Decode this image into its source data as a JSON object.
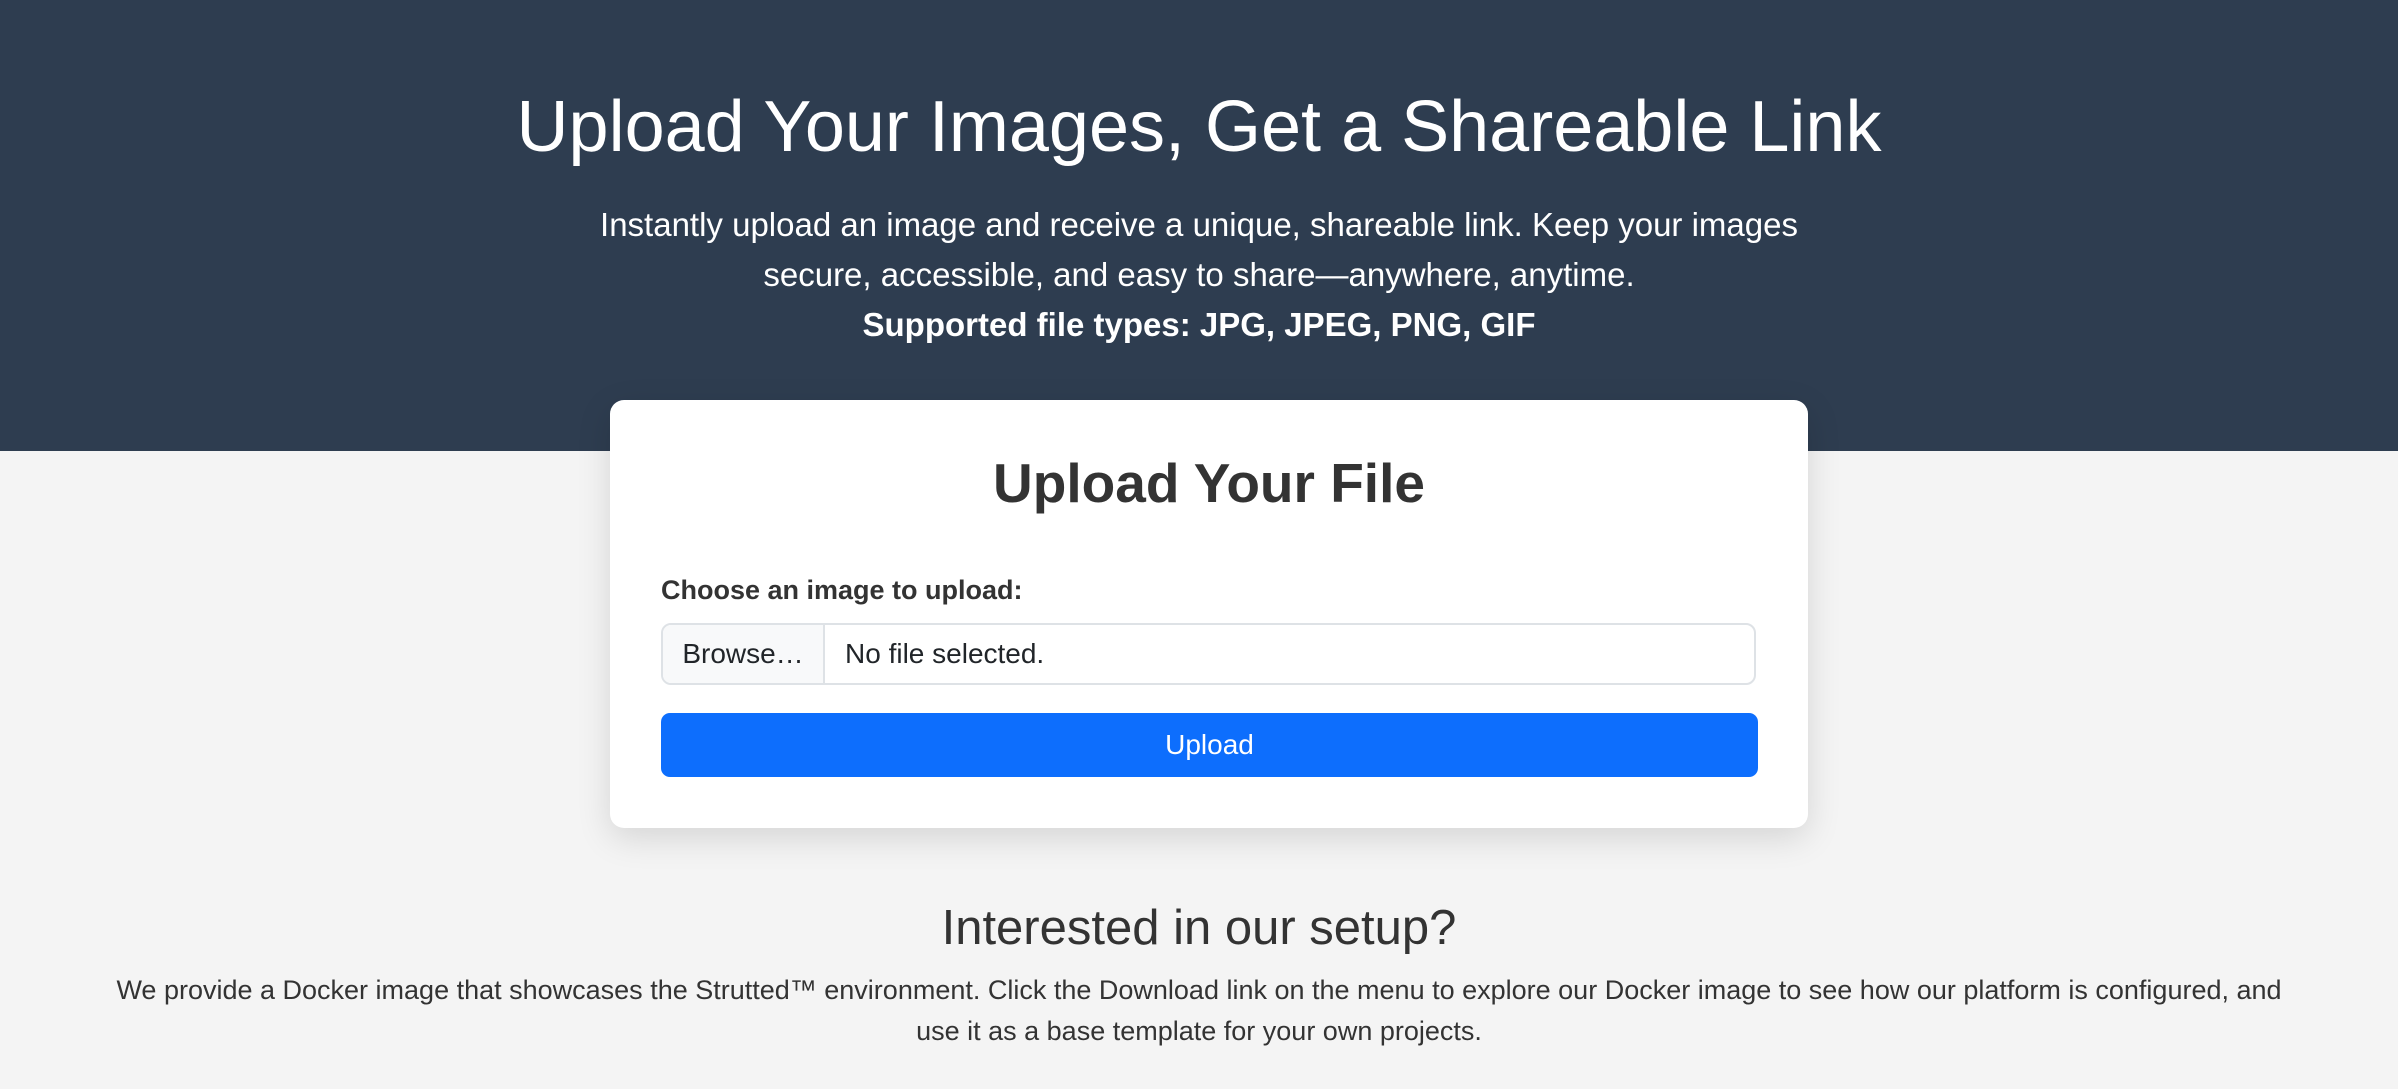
{
  "hero": {
    "title": "Upload Your Images, Get a Shareable Link",
    "description": "Instantly upload an image and receive a unique, shareable link. Keep your images secure, accessible, and easy to share—anywhere, anytime.",
    "supported_types": "Supported file types: JPG, JPEG, PNG, GIF",
    "background_color": "#2e3d50"
  },
  "upload_card": {
    "title": "Upload Your File",
    "file_label": "Choose an image to upload:",
    "browse_label": "Browse…",
    "file_status": "No file selected.",
    "upload_label": "Upload",
    "accent_color": "#0d6efd"
  },
  "setup": {
    "title": "Interested in our setup?",
    "description": "We provide a Docker image that showcases the Strutted™ environment. Click the Download link on the menu to explore our Docker image to see how our platform is configured, and use it as a base template for your own projects."
  }
}
